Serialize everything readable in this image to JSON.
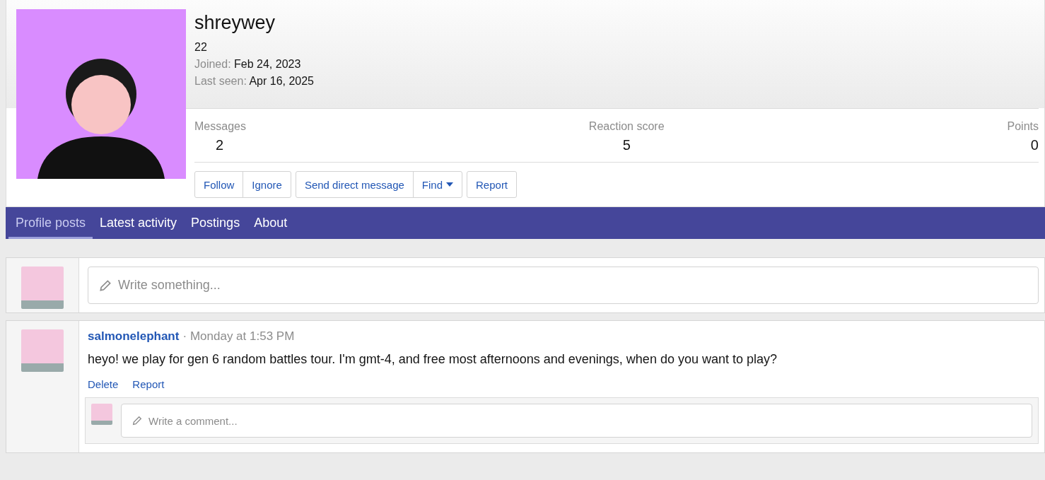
{
  "profile": {
    "username": "shreywey",
    "age": "22",
    "joined": {
      "label": "Joined:",
      "value": "Feb 24, 2023"
    },
    "last_seen": {
      "label": "Last seen:",
      "value": "Apr 16, 2025"
    },
    "stats": [
      {
        "label": "Messages",
        "value": "2"
      },
      {
        "label": "Reaction score",
        "value": "5"
      },
      {
        "label": "Points",
        "value": "0"
      }
    ],
    "button_groups": [
      [
        {
          "label": "Follow"
        },
        {
          "label": "Ignore"
        }
      ],
      [
        {
          "label": "Send direct message"
        },
        {
          "label": "Find",
          "dropdown": true
        }
      ],
      [
        {
          "label": "Report"
        }
      ]
    ]
  },
  "tabs": [
    {
      "label": "Profile posts",
      "selected": true
    },
    {
      "label": "Latest activity",
      "selected": false
    },
    {
      "label": "Postings",
      "selected": false
    },
    {
      "label": "About",
      "selected": false
    }
  ],
  "composer": {
    "placeholder": "Write something..."
  },
  "posts": [
    {
      "author": "salmonelephant",
      "time": "· Monday at 1:53 PM",
      "text": "heyo! we play for gen 6 random battles tour. I'm gmt-4, and free most afternoons and evenings, when do you want to play?",
      "actions": [
        "Delete",
        "Report"
      ],
      "comment_placeholder": "Write a comment..."
    }
  ]
}
